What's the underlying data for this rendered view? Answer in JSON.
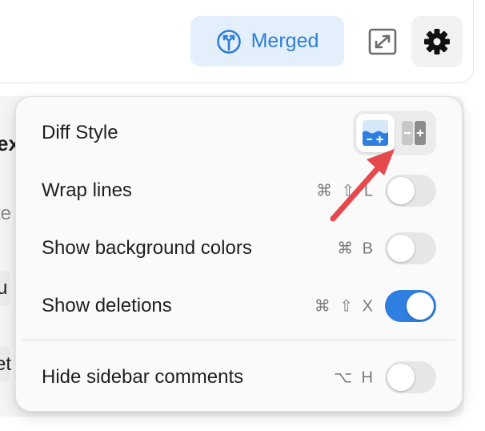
{
  "header": {
    "merged_label": "Merged",
    "merged_icon": "merge-icon",
    "expand_icon": "expand-icon",
    "settings_icon": "gear-icon",
    "colors": {
      "merged_bg": "#e3f0fc",
      "merged_fg": "#2f7fd6"
    }
  },
  "background": {
    "fragments": [
      "ex",
      "te",
      "u",
      "et"
    ]
  },
  "menu": {
    "diff_style": {
      "label": "Diff Style",
      "options": [
        "unified-diff-icon",
        "split-diff-icon"
      ],
      "selected": "unified-diff-icon"
    },
    "wrap_lines": {
      "label": "Wrap lines",
      "shortcut": "⌘ ⇧ L",
      "enabled": false
    },
    "background_colors": {
      "label": "Show background colors",
      "shortcut": "⌘ B",
      "enabled": false
    },
    "deletions": {
      "label": "Show deletions",
      "shortcut": "⌘ ⇧ X",
      "enabled": true
    },
    "hide_comments": {
      "label": "Hide sidebar comments",
      "shortcut": "⌥ H",
      "enabled": false
    }
  },
  "annotation": {
    "arrow_color": "#e5484d"
  },
  "colors": {
    "toggle_on": "#2e7fe0",
    "toggle_off": "#e6e6e6"
  }
}
